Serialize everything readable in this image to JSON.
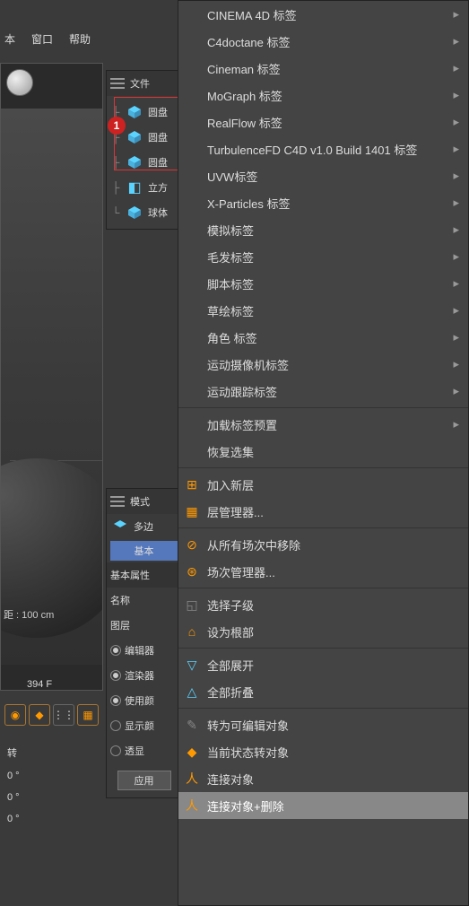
{
  "menubar": {
    "items": [
      "本",
      "窗口",
      "帮助"
    ]
  },
  "viewport": {
    "distance_label": "距 : 100 cm",
    "frame": "394 F"
  },
  "bottom_values": {
    "r1": "转",
    "r2": "0 °",
    "r3": "0 °",
    "r4": "0 °"
  },
  "obj_panel": {
    "header": "文件",
    "items": [
      {
        "label": "圆盘",
        "icon": "cylinder"
      },
      {
        "label": "圆盘",
        "icon": "cylinder"
      },
      {
        "label": "圆盘",
        "icon": "cylinder"
      },
      {
        "label": "立方",
        "icon": "cube"
      },
      {
        "label": "球体",
        "icon": "sphere"
      }
    ]
  },
  "attr_panel": {
    "mode_header": "模式",
    "poly_label": "多边",
    "basic_tab": "基本",
    "section": "基本属性",
    "rows": {
      "name": "名称",
      "layer": "图层",
      "editor": "编辑器",
      "render": "渲染器",
      "use": "使用颜",
      "display": "显示颜",
      "trans": "透显"
    },
    "apply": "应用"
  },
  "context_menu": {
    "items": [
      {
        "label": "CINEMA 4D 标签",
        "sub": true
      },
      {
        "label": "C4doctane 标签",
        "sub": true
      },
      {
        "label": "Cineman 标签",
        "sub": true
      },
      {
        "label": "MoGraph 标签",
        "sub": true
      },
      {
        "label": "RealFlow 标签",
        "sub": true
      },
      {
        "label": "TurbulenceFD C4D v1.0 Build 1401 标签",
        "sub": true
      },
      {
        "label": "UVW标签",
        "sub": true
      },
      {
        "label": "X-Particles 标签",
        "sub": true
      },
      {
        "label": "模拟标签",
        "sub": true
      },
      {
        "label": "毛发标签",
        "sub": true
      },
      {
        "label": "脚本标签",
        "sub": true
      },
      {
        "label": "草绘标签",
        "sub": true
      },
      {
        "label": "角色 标签",
        "sub": true
      },
      {
        "label": "运动摄像机标签",
        "sub": true
      },
      {
        "label": "运动跟踪标签",
        "sub": true
      },
      {
        "sep": true
      },
      {
        "label": "加载标签预置",
        "sub": true
      },
      {
        "label": "恢复选集"
      },
      {
        "sep": true
      },
      {
        "label": "加入新层",
        "icon": "layer-add",
        "color": "orange"
      },
      {
        "label": "层管理器...",
        "icon": "layer-mgr",
        "color": "orange"
      },
      {
        "sep": true
      },
      {
        "label": "从所有场次中移除",
        "icon": "remove-scene",
        "color": "orange"
      },
      {
        "label": "场次管理器...",
        "icon": "scene-mgr",
        "color": "orange"
      },
      {
        "sep": true
      },
      {
        "label": "选择子级",
        "icon": "select-child"
      },
      {
        "label": "设为根部",
        "icon": "set-root",
        "color": "orange"
      },
      {
        "sep": true
      },
      {
        "label": "全部展开",
        "icon": "expand-all",
        "color": "blue"
      },
      {
        "label": "全部折叠",
        "icon": "collapse-all",
        "color": "blue"
      },
      {
        "sep": true
      },
      {
        "label": "转为可编辑对象",
        "icon": "editable",
        "color": "gray"
      },
      {
        "label": "当前状态转对象",
        "icon": "state-obj",
        "color": "orange"
      },
      {
        "label": "连接对象",
        "icon": "connect",
        "color": "orange"
      },
      {
        "label": "连接对象+删除",
        "icon": "connect-del",
        "color": "orange",
        "highlight": true
      }
    ]
  }
}
